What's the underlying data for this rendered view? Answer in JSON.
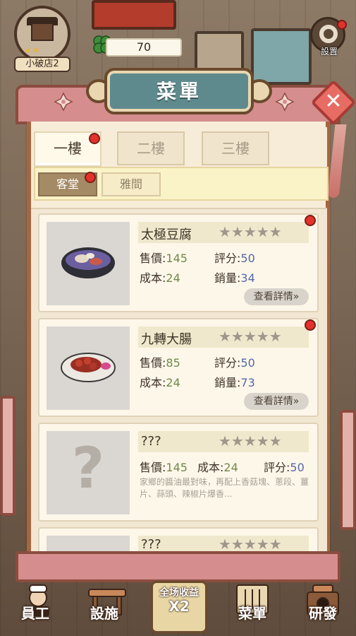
{
  "hud": {
    "shop_stars": "★★",
    "shop_name": "小破店2",
    "currency_icon": "clover-icon",
    "currency_value": "70",
    "settings_label": "設置"
  },
  "panel": {
    "title": "菜單",
    "close_icon": "✕"
  },
  "floor_tabs": [
    {
      "label": "一樓",
      "active": true
    },
    {
      "label": "二樓",
      "active": false
    },
    {
      "label": "三樓",
      "active": false
    }
  ],
  "room_tabs": [
    {
      "label": "客堂",
      "active": true
    },
    {
      "label": "雅間",
      "active": false
    }
  ],
  "labels": {
    "price": "售價:",
    "rating": "評分:",
    "cost": "成本:",
    "sales": "銷量:",
    "details": "查看詳情»"
  },
  "dishes": [
    {
      "name": "太極豆腐",
      "price": "145",
      "rating": "50",
      "cost": "24",
      "sales": "34",
      "stars": "★★★★★"
    },
    {
      "name": "九轉大腸",
      "price": "85",
      "rating": "50",
      "cost": "24",
      "sales": "73",
      "stars": "★★★★★"
    },
    {
      "name": "???",
      "price": "145",
      "cost": "24",
      "rating": "50",
      "stars": "★★★★★",
      "question_mark": "?",
      "description": "家鄉的醬油最對味，再配上香菇塊、蔥段、薑片、蒜頭、辣椒片爆香..."
    },
    {
      "name": "???",
      "stars": "★★★★★"
    }
  ],
  "nav": {
    "staff": "員工",
    "facilities": "設施",
    "income_label": "全场收益",
    "income_multiplier": "X2",
    "menu": "菜單",
    "research": "研發"
  },
  "colors": {
    "accent_red": "#e3322b",
    "panel_pink": "#d58d8d",
    "plaque_teal": "#5e8a8e",
    "value_green": "#6f8a46",
    "value_blue": "#5566a8"
  }
}
